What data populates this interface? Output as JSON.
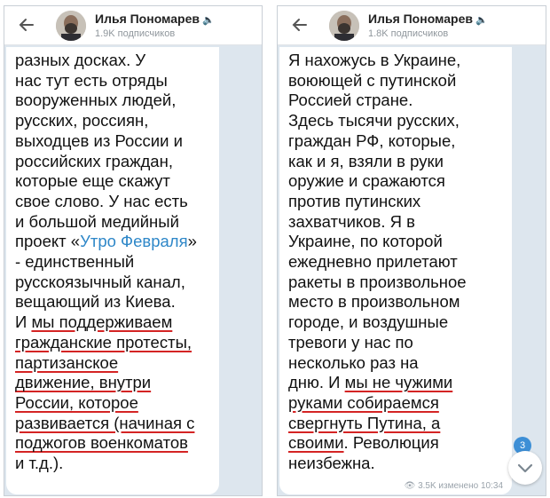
{
  "left": {
    "header": {
      "channel_name": "Илья Пономарев",
      "subscribers": "1.9K подписчиков"
    },
    "message": {
      "line_top": "разных досках. У\nнас тут есть отряды\nвооруженных людей,\nрусских, россиян,\nвыходцев из России и\nроссийских граждан,\nкоторые еще скажут\nсвое слово. У нас есть\nи большой медийный\nпроект «",
      "link": "Утро Февраля",
      "line_mid": "»\n- единственный\nрусскоязычный канал,\nвещающий из Киева.\nИ ",
      "underlined": "мы поддерживаем\nгражданские протесты,\nпартизанское\nдвижение, внутри\nРоссии, которое\nразвивается (начиная с\nподжогов военкоматов",
      "line_end": "\nи т.д.)."
    }
  },
  "right": {
    "header": {
      "channel_name": "Илья Пономарев",
      "subscribers": "1.8K подписчиков"
    },
    "message": {
      "text_top": "Я нахожусь в Украине,\nвоюющей с путинской\nРоссией стране.\nЗдесь тысячи русских,\nграждан РФ, которые,\nкак и я, взяли в руки\nоружие и сражаются\nпротив путинских\nзахватчиков. Я в\nУкраине, по которой\nежедневно прилетают\nракеты в произвольное\nместо в произвольном\nгороде, и воздушные\nтревоги у нас по\nнесколько раз на\nдню. И ",
      "underlined": "мы не чужими\nруками собираемся\nсвергнуть Путина, а\nсвоими",
      "text_end": ". Революция\nнеизбежна.",
      "views": "3.5K",
      "edited": "изменено 10:34"
    },
    "badge_count": "3"
  }
}
